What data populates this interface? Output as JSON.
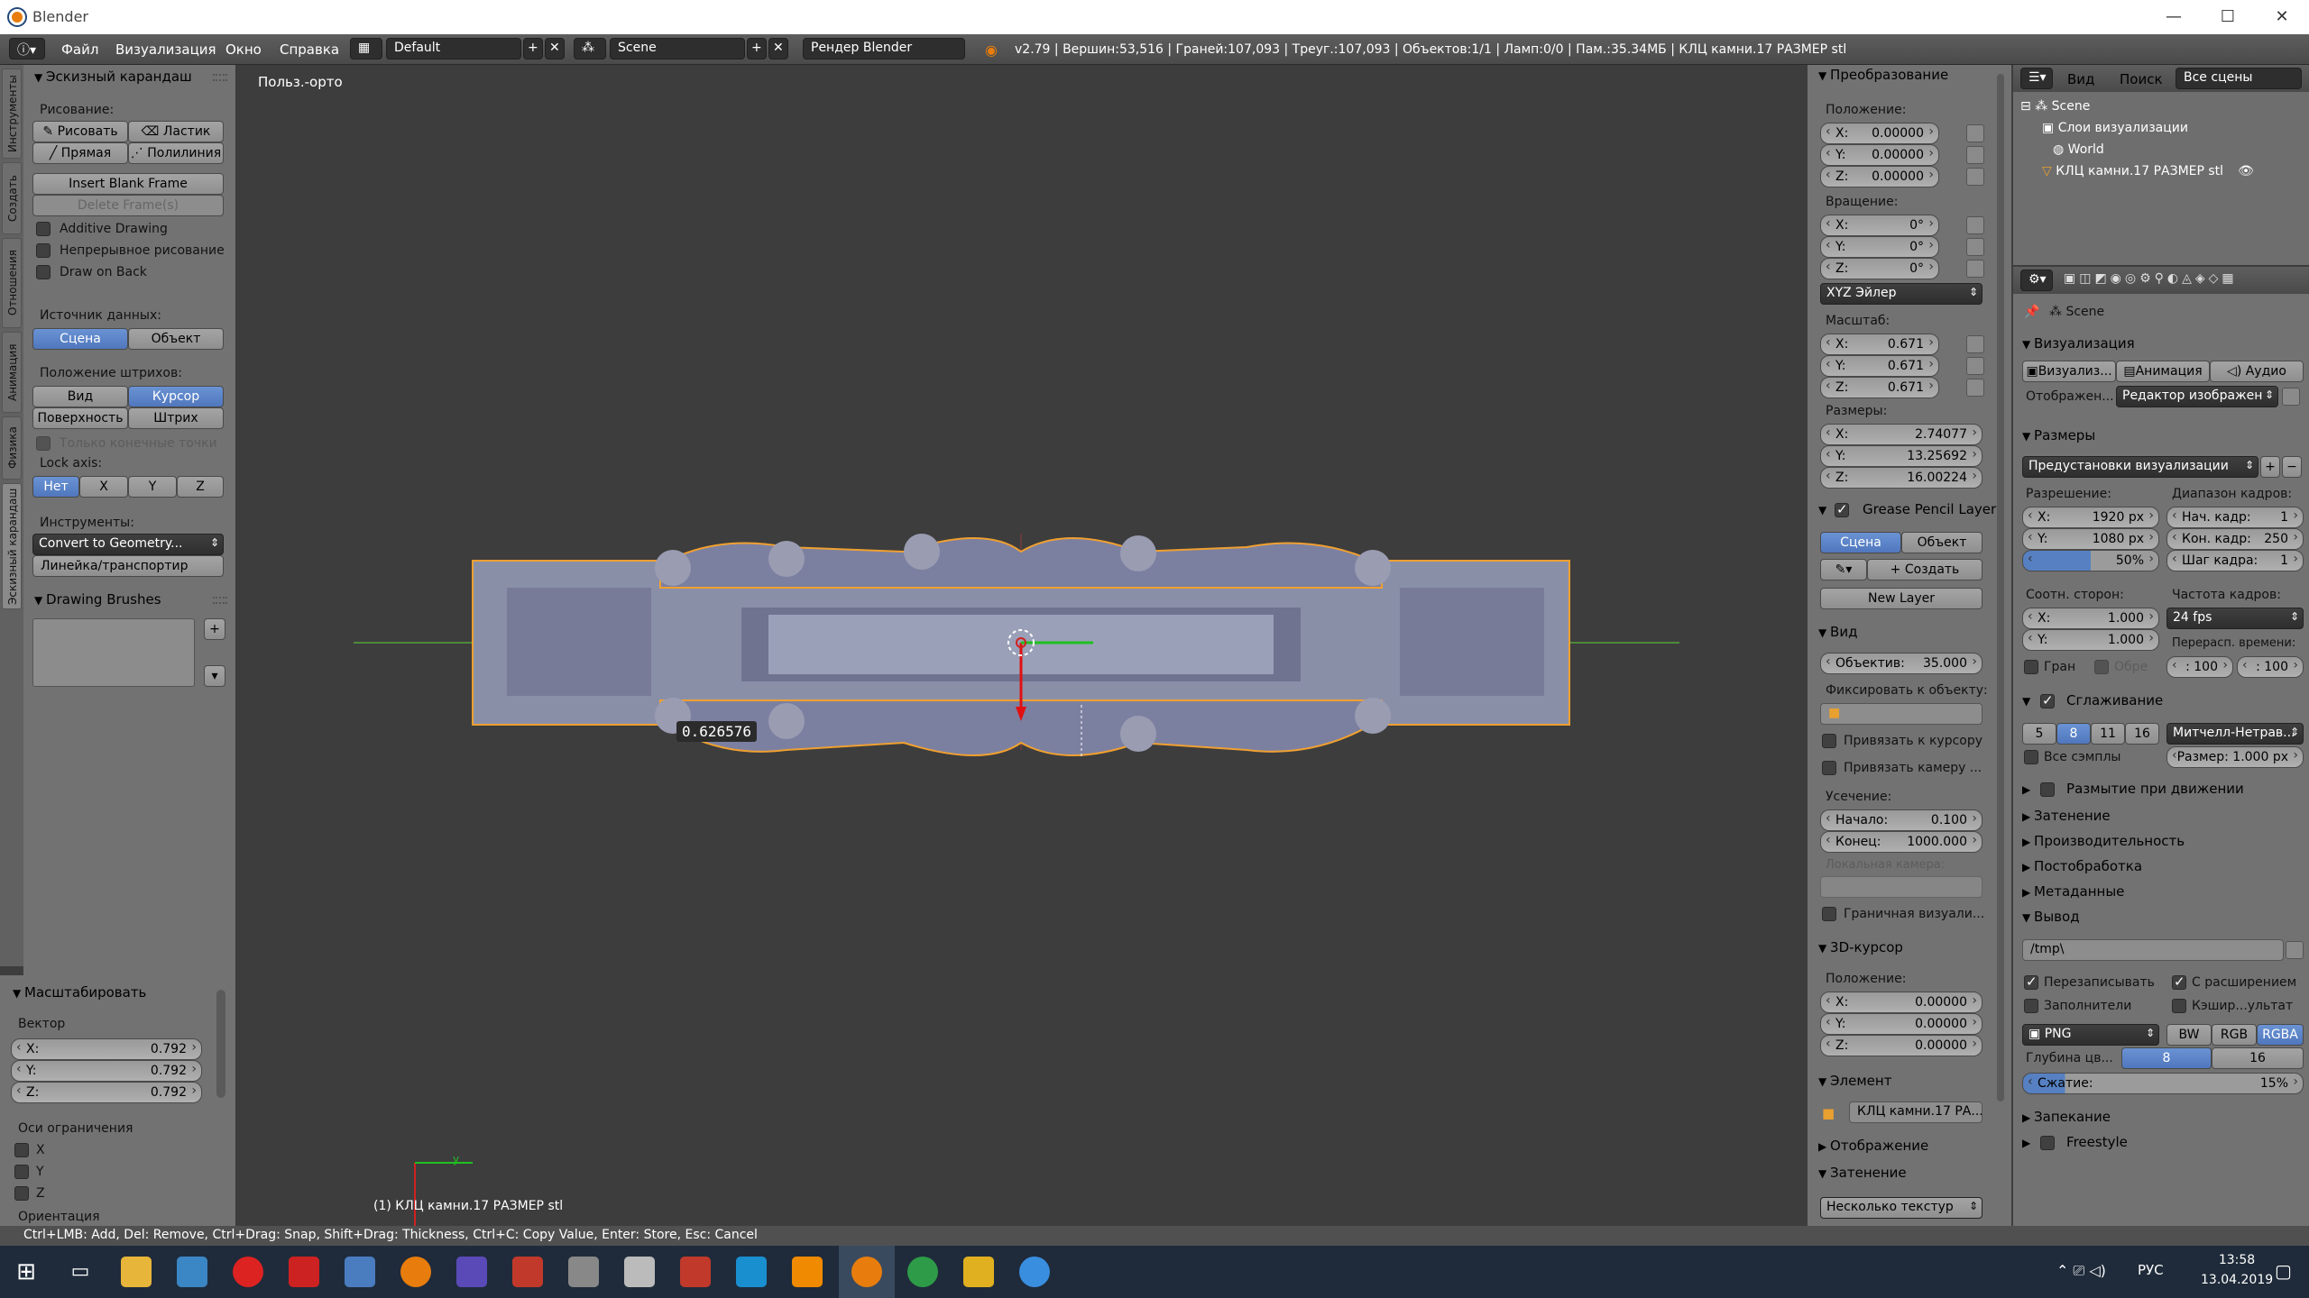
{
  "window": {
    "title": "Blender"
  },
  "topbar": {
    "menus": [
      "Файл",
      "Визуализация",
      "Окно",
      "Справка"
    ],
    "layout": "Default",
    "scene": "Scene",
    "engine": "Рендер Blender",
    "stats": "v2.79 | Вершин:53,516 | Граней:107,093 | Треуг.:107,093 | Объектов:1/1 | Ламп:0/0 | Пам.:35.34МБ | КЛЦ камни.17 РАЗМЕР stl"
  },
  "vtabs": [
    "Инструменты",
    "Создать",
    "Отношения",
    "Анимация",
    "Физика",
    "Эскизный карандаш"
  ],
  "tools": {
    "header": "Эскизный карандаш",
    "draw_label": "Рисование:",
    "draw": "Рисовать",
    "erase": "Ластик",
    "line": "Прямая",
    "poly": "Полилиния",
    "insert_blank": "Insert Blank Frame",
    "delete_frames": "Delete Frame(s)",
    "additive": "Additive Drawing",
    "continuous": "Непрерывное рисование",
    "draw_back": "Draw on Back",
    "source_label": "Источник данных:",
    "src_scene": "Сцена",
    "src_object": "Объект",
    "placement_label": "Положение штрихов:",
    "p_view": "Вид",
    "p_cursor": "Курсор",
    "p_surface": "Поверхность",
    "p_stroke": "Штрих",
    "endpoints": "Только конечные точки",
    "lock_label": "Lock axis:",
    "lock_none": "Нет",
    "lock_x": "X",
    "lock_y": "Y",
    "lock_z": "Z",
    "instr_label": "Инструменты:",
    "convert": "Convert to Geometry...",
    "ruler": "Линейка/транспортир",
    "brushes": "Drawing Brushes"
  },
  "operator": {
    "header": "Масштабировать",
    "vector": "Вектор",
    "x": "0.792",
    "y": "0.792",
    "z": "0.792",
    "constraint": "Оси ограничения",
    "cx": "X",
    "cy": "Y",
    "cz": "Z",
    "orient": "Ориентация"
  },
  "viewport": {
    "label": "Польз.-орто",
    "object_label": "(1) КЛЦ камни.17 РАЗМЕР stl",
    "scale_readout": "0.626576",
    "axis_y": "y"
  },
  "rpanel": {
    "transform": "Преобразование",
    "loc_label": "Положение:",
    "loc": [
      "0.00000",
      "0.00000",
      "0.00000"
    ],
    "rot_label": "Вращение:",
    "rot": [
      "0°",
      "0°",
      "0°"
    ],
    "rot_mode": "XYZ Эйлер",
    "scale_label": "Масштаб:",
    "scale": [
      "0.671",
      "0.671",
      "0.671"
    ],
    "dim_label": "Размеры:",
    "dim": [
      "2.74077",
      "13.25692",
      "16.00224"
    ],
    "gp_layer": "Grease Pencil Layer",
    "gp_scene": "Сцена",
    "gp_object": "Объект",
    "gp_create": "Создать",
    "new_layer": "New Layer",
    "view": "Вид",
    "lens": "Объектив:",
    "lens_val": "35.000",
    "lock_obj": "Фиксировать к объекту:",
    "lock_cursor": "Привязать к курсору",
    "lock_camera": "Привязать камеру ...",
    "clip": "Усечение:",
    "clip_start": "Начало:",
    "clip_start_val": "0.100",
    "clip_end": "Конец:",
    "clip_end_val": "1000.000",
    "local_cam": "Локальная камера:",
    "border": "Граничная визуали...",
    "cursor": "3D-курсор",
    "cur_label": "Положение:",
    "cur": [
      "0.00000",
      "0.00000",
      "0.00000"
    ],
    "item": "Элемент",
    "item_name": "КЛЦ камни.17 РА...",
    "display": "Отображение",
    "shading": "Затенение",
    "shading_mode": "Несколько текстур",
    "axes": [
      "X:",
      "Y:",
      "Z:"
    ]
  },
  "outliner": {
    "view": "Вид",
    "search": "Поиск",
    "filter": "Все сцены",
    "items": [
      "Scene",
      "Слои визуализации",
      "World",
      "КЛЦ камни.17 РАЗМЕР stl"
    ]
  },
  "props": {
    "scene": "Scene",
    "render": "Визуализация",
    "tab_render": "Визуализ...",
    "tab_anim": "Анимация",
    "tab_audio": "Аудио",
    "display_label": "Отображен...",
    "display_val": "Редактор изображен",
    "dims": "Размеры",
    "presets": "Предустановки визуализации",
    "res_label": "Разрешение:",
    "res_x": "1920 px",
    "res_y": "1080 px",
    "res_pct": "50%",
    "frames_label": "Диапазон кадров:",
    "f_start": "Нач. кадр:",
    "f_start_v": "1",
    "f_end": "Кон. кадр:",
    "f_end_v": "250",
    "f_step": "Шаг кадра:",
    "f_step_v": "1",
    "aspect_label": "Соотн. сторон:",
    "asp_x": "1.000",
    "asp_y": "1.000",
    "fps_label": "Частота кадров:",
    "fps": "24 fps",
    "remap": "Перерасп. времени:",
    "remap_a": ": 100",
    "remap_b": ": 100",
    "border": "Гран",
    "crop": "Обре",
    "aa": "Сглаживание",
    "aa_5": "5",
    "aa_8": "8",
    "aa_11": "11",
    "aa_16": "16",
    "aa_filter": "Митчелл-Нетрав...",
    "all_samples": "Все сэмплы",
    "aa_size": "Размер: 1.000 px",
    "motion_blur": "Размытие при движении",
    "shading": "Затенение",
    "perf": "Производительность",
    "post": "Постобработка",
    "meta": "Метаданные",
    "output": "Вывод",
    "out_path": "/tmp\\",
    "overwrite": "Перезаписывать",
    "ext": "С расширением",
    "placeholders": "Заполнители",
    "cache": "Кэшир...ультат",
    "format": "PNG",
    "bw": "BW",
    "rgb": "RGB",
    "rgba": "RGBA",
    "depth_label": "Глубина цв...",
    "depth_8": "8",
    "depth_16": "16",
    "compress": "Сжатие:",
    "compress_val": "15%",
    "compress_frac": 0.15,
    "bake": "Запекание",
    "freestyle": "Freestyle"
  },
  "status": "Ctrl+LMB: Add, Del: Remove, Ctrl+Drag: Snap, Shift+Drag: Thickness, Ctrl+C: Copy Value, Enter: Store,  Esc: Cancel",
  "taskbar": {
    "lang": "РУС",
    "time": "13:58",
    "date": "13.04.2019"
  },
  "colors": {
    "selected": "#5680c2",
    "object_outline": "#f0a030",
    "bg": "#3d3d3d"
  }
}
